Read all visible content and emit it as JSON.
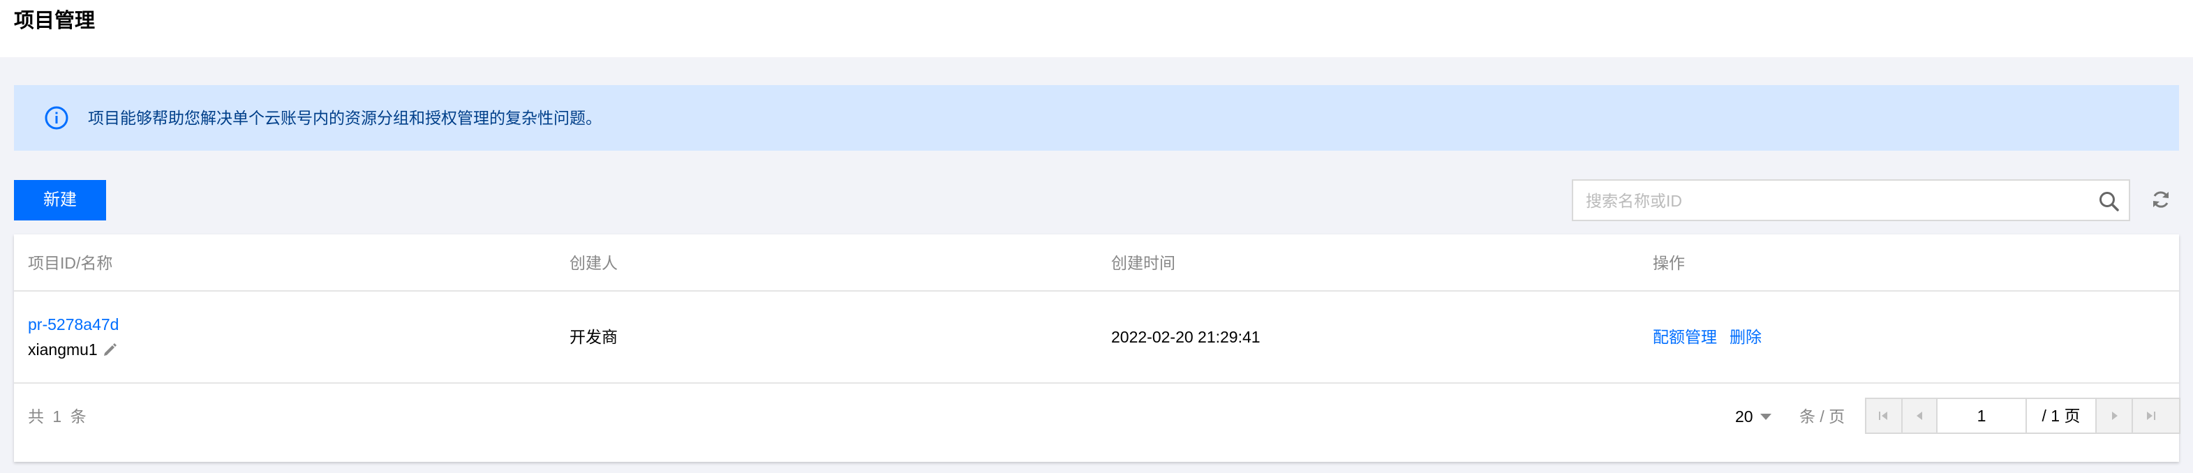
{
  "page": {
    "title": "项目管理"
  },
  "banner": {
    "text": "项目能够帮助您解决单个云账号内的资源分组和授权管理的复杂性问题。"
  },
  "toolbar": {
    "new_label": "新建",
    "search_placeholder": "搜索名称或ID",
    "search_value": ""
  },
  "table": {
    "headers": [
      "项目ID/名称",
      "创建人",
      "创建时间",
      "操作"
    ],
    "rows": [
      {
        "id": "pr-5278a47d",
        "name": "xiangmu1",
        "creator": "开发商",
        "created_at": "2022-02-20 21:29:41",
        "actions": [
          "配额管理",
          "删除"
        ]
      }
    ]
  },
  "footer": {
    "total_text": "共 1 条",
    "page_size": "20",
    "per_page_label": "条 / 页",
    "current_page": "1",
    "total_pages_text": "/ 1 页"
  },
  "colors": {
    "primary": "#006eff",
    "banner_bg": "#d5e7ff",
    "banner_text": "#003f89",
    "page_bg": "#f2f3f8"
  },
  "icons": [
    "info-icon",
    "search-icon",
    "refresh-icon",
    "pencil-icon",
    "first-page-icon",
    "prev-page-icon",
    "next-page-icon",
    "last-page-icon"
  ]
}
